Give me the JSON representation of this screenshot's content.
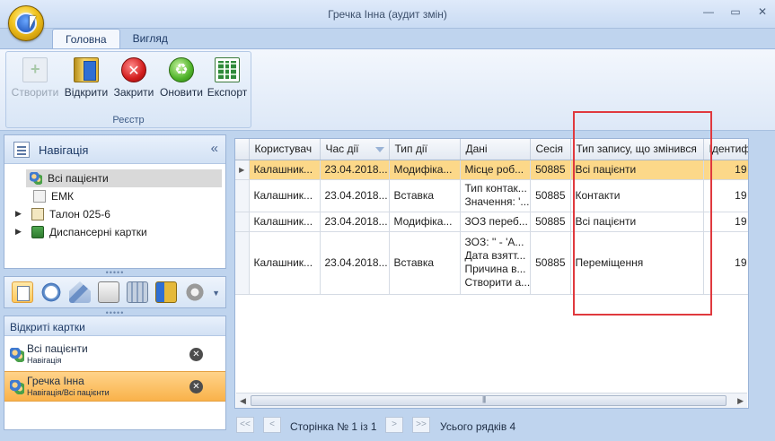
{
  "window": {
    "title": "Гречка Інна (аудит змін)"
  },
  "ribbon": {
    "tabs": [
      {
        "label": "Головна"
      },
      {
        "label": "Вигляд"
      }
    ],
    "group_label": "Реєстр",
    "buttons": [
      {
        "label": "Створити",
        "icon": "create-icon",
        "enabled": false
      },
      {
        "label": "Відкрити",
        "icon": "open-icon",
        "enabled": true
      },
      {
        "label": "Закрити",
        "icon": "close-red-icon",
        "enabled": true
      },
      {
        "label": "Оновити",
        "icon": "refresh-icon",
        "enabled": true
      },
      {
        "label": "Експорт",
        "icon": "excel-export-icon",
        "enabled": true
      }
    ]
  },
  "navigation": {
    "title": "Навігація",
    "items": [
      {
        "label": "Всі пацієнти",
        "selected": true,
        "expandable": false
      },
      {
        "label": "ЕМК",
        "selected": false,
        "expandable": false
      },
      {
        "label": "Талон 025-6",
        "selected": false,
        "expandable": true
      },
      {
        "label": "Диспансерні картки",
        "selected": false,
        "expandable": true
      }
    ]
  },
  "open_cards": {
    "title": "Відкриті картки",
    "items": [
      {
        "title": "Всі пацієнти",
        "subtitle": "Навігація",
        "active": false
      },
      {
        "title": "Гречка Інна",
        "subtitle": "Навігація/Всі пацієнти",
        "active": true
      }
    ]
  },
  "grid": {
    "columns": [
      "Користувач",
      "Час дії",
      "Тип дії",
      "Дані",
      "Сесія",
      "Тип запису, що змінився",
      "Ідентиф"
    ],
    "rows": [
      {
        "user": "Калашник...",
        "time": "23.04.2018...",
        "action": "Модифіка...",
        "data": [
          "Місце роб..."
        ],
        "session": "50885",
        "record_type": "Всі пацієнти",
        "id": "19",
        "selected": true
      },
      {
        "user": "Калашник...",
        "time": "23.04.2018...",
        "action": "Вставка",
        "data": [
          "Тип контак...",
          "Значення: '..."
        ],
        "session": "50885",
        "record_type": "Контакти",
        "id": "19",
        "selected": false
      },
      {
        "user": "Калашник...",
        "time": "23.04.2018...",
        "action": "Модифіка...",
        "data": [
          "ЗОЗ переб..."
        ],
        "session": "50885",
        "record_type": "Всі пацієнти",
        "id": "19",
        "selected": false
      },
      {
        "user": "Калашник...",
        "time": "23.04.2018...",
        "action": "Вставка",
        "data": [
          "ЗОЗ: '' - 'А...",
          "Дата взятт...",
          "Причина в...",
          "Створити а..."
        ],
        "session": "50885",
        "record_type": "Переміщення",
        "id": "19",
        "selected": false
      }
    ]
  },
  "pager": {
    "first": "<<",
    "prev": "<",
    "next": ">",
    "last": ">>",
    "page_text": "Сторінка № 1 із 1",
    "total_text": "Усього рядків 4"
  },
  "colors": {
    "selected_row": "#fcd889",
    "highlight_box": "#e0393e",
    "active_card": "#f9b24a"
  }
}
